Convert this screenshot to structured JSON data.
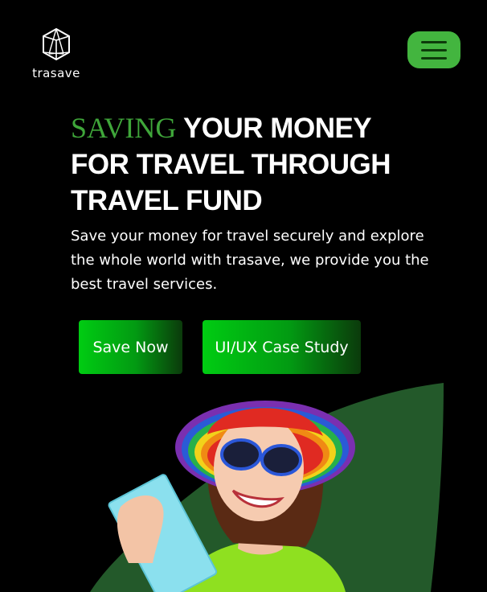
{
  "brand": {
    "name": "trasave",
    "logo_icon": "cube-outline-icon"
  },
  "nav": {
    "menu_icon": "hamburger-menu-icon",
    "menu_color": "#43b53f"
  },
  "hero": {
    "title_accent": "SAVING",
    "title_line1_rest": " YOUR MONEY",
    "title_line2": "FOR TRAVEL THROUGH",
    "title_line3": "TRAVEL FUND",
    "accent_color": "#3fa63a",
    "description": "Save your money for travel securely and explore the whole world with trasave, we provide you the best travel services."
  },
  "actions": {
    "primary_label": "Save Now",
    "secondary_label": "UI/UX Case Study"
  },
  "illustration": {
    "subject": "woman-with-rainbow-hat-and-ticket",
    "leaf_color": "#23592a"
  }
}
